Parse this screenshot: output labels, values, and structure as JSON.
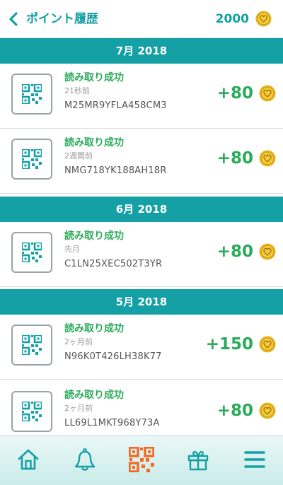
{
  "header": {
    "title": "ポイント履歴",
    "points": "2000",
    "back_icon": "chevron-left-icon",
    "coin_icon": "coin-icon"
  },
  "colors": {
    "teal": "#14a0a5",
    "green": "#2aab5a",
    "gold": "#e5b31f",
    "nav_active": "#f36a21"
  },
  "history": {
    "sections": [
      {
        "month": "7月 2018",
        "entries": [
          {
            "title": "読み取り成功",
            "time": "21秒前",
            "code": "M25MR9YFLA458CM3",
            "points": "+80"
          },
          {
            "title": "読み取り成功",
            "time": "2週間前",
            "code": "NMG718YK188AH18R",
            "points": "+80"
          }
        ]
      },
      {
        "month": "6月 2018",
        "entries": [
          {
            "title": "読み取り成功",
            "time": "先月",
            "code": "C1LN25XEC502T3YR",
            "points": "+80"
          }
        ]
      },
      {
        "month": "5月 2018",
        "entries": [
          {
            "title": "読み取り成功",
            "time": "2ヶ月前",
            "code": "N96K0T426LH38K77",
            "points": "+150"
          },
          {
            "title": "読み取り成功",
            "time": "2ヶ月前",
            "code": "LL69L1MKT968Y73A",
            "points": "+80"
          }
        ]
      }
    ]
  },
  "nav": {
    "items": [
      {
        "name": "home-icon",
        "active": false
      },
      {
        "name": "bell-icon",
        "active": false
      },
      {
        "name": "qr-code-icon",
        "active": true
      },
      {
        "name": "gift-icon",
        "active": false
      },
      {
        "name": "menu-icon",
        "active": false
      }
    ]
  }
}
